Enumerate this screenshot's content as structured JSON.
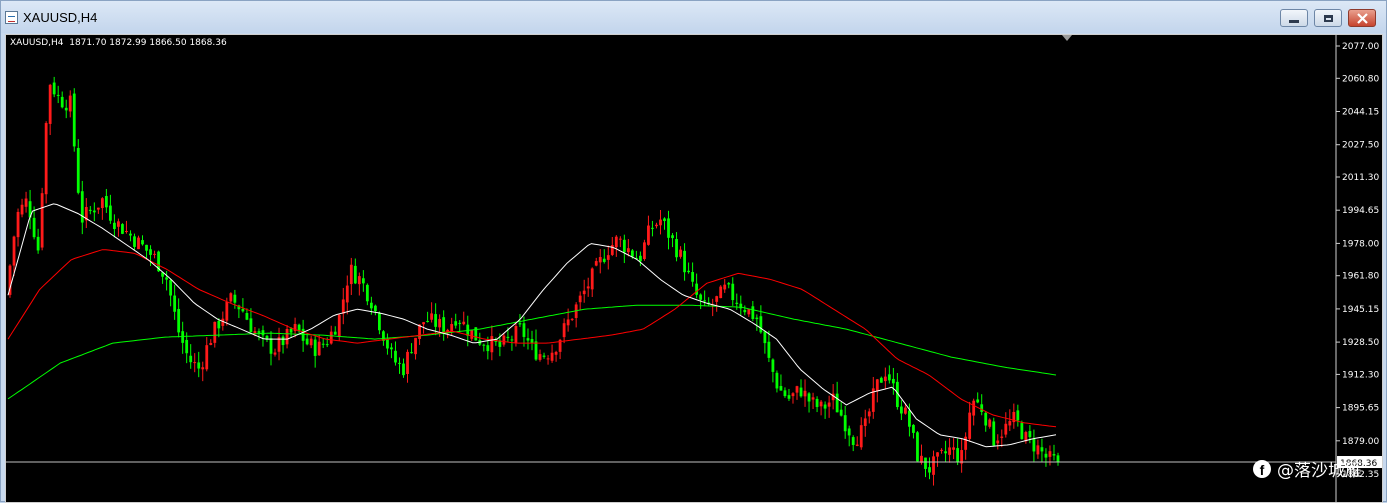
{
  "window": {
    "title": "XAUUSD,H4"
  },
  "chart": {
    "info_line": "XAUUSD,H4  1871.70 1872.99 1866.50 1868.36",
    "ticks": [
      "2077.00",
      "2060.80",
      "2044.15",
      "2027.50",
      "2011.30",
      "1994.65",
      "1978.00",
      "1961.80",
      "1945.15",
      "1928.50",
      "1912.30",
      "1895.65",
      "1879.00",
      "1862.35"
    ],
    "current_price": "1868.36",
    "colors": {
      "bull": "#ff1a1a",
      "bear": "#00ff00",
      "ma_fast": "#ffffff",
      "ma_mid": "#ff0000",
      "ma_slow": "#00ff00",
      "price_line": "#c0c0c0"
    }
  },
  "watermark": {
    "text": "@落沙城雁",
    "icon": "facebook-icon"
  },
  "chart_data": {
    "type": "candlestick",
    "symbol": "XAUUSD",
    "timeframe": "H4",
    "last_bar": {
      "open": 1871.7,
      "high": 1872.99,
      "low": 1866.5,
      "close": 1868.36
    },
    "ylim": [
      1853,
      2080
    ],
    "close_path": [
      1952,
      1992,
      2000,
      1975,
      2060,
      2050,
      2048,
      1990,
      1995,
      2000,
      1990,
      1985,
      1980,
      1975,
      1970,
      1960,
      1935,
      1920,
      1915,
      1930,
      1940,
      1950,
      1945,
      1935,
      1928,
      1925,
      1930,
      1935,
      1928,
      1925,
      1930,
      1940,
      1965,
      1960,
      1950,
      1935,
      1920,
      1915,
      1930,
      1940,
      1938,
      1935,
      1942,
      1935,
      1930,
      1928,
      1926,
      1930,
      1935,
      1925,
      1922,
      1925,
      1935,
      1945,
      1955,
      1965,
      1975,
      1980,
      1975,
      1970,
      1985,
      1990,
      1980,
      1970,
      1955,
      1945,
      1948,
      1955,
      1950,
      1945,
      1940,
      1920,
      1905,
      1900,
      1905,
      1898,
      1895,
      1900,
      1890,
      1880,
      1885,
      1905,
      1915,
      1900,
      1890,
      1870,
      1865,
      1870,
      1875,
      1870,
      1900,
      1895,
      1880,
      1885,
      1890,
      1880,
      1876,
      1870,
      1868.36
    ],
    "series": [
      {
        "name": "",
        "line": "ma_fast",
        "values": [
          1952,
          1994,
          1998,
          1993,
          1986,
          1978,
          1970,
          1960,
          1948,
          1940,
          1935,
          1930,
          1930,
          1935,
          1942,
          1945,
          1943,
          1940,
          1935,
          1932,
          1928,
          1930,
          1940,
          1955,
          1968,
          1978,
          1976,
          1970,
          1960,
          1952,
          1948,
          1945,
          1938,
          1930,
          1915,
          1905,
          1897,
          1903,
          1906,
          1890,
          1882,
          1880,
          1876,
          1877,
          1880,
          1882
        ]
      },
      {
        "name": "",
        "line": "ma_mid",
        "values": [
          1930,
          1955,
          1970,
          1975,
          1973,
          1965,
          1955,
          1948,
          1942,
          1935,
          1930,
          1928,
          1930,
          1932,
          1934,
          1930,
          1928,
          1928,
          1930,
          1932,
          1935,
          1945,
          1958,
          1963,
          1960,
          1955,
          1945,
          1935,
          1920,
          1912,
          1900,
          1892,
          1888,
          1886
        ]
      },
      {
        "name": "",
        "line": "ma_slow",
        "values": [
          1900,
          1918,
          1928,
          1931,
          1932,
          1933,
          1932,
          1930,
          1932,
          1935,
          1940,
          1945,
          1947,
          1947,
          1946,
          1940,
          1935,
          1928,
          1921,
          1916,
          1912
        ]
      }
    ]
  }
}
